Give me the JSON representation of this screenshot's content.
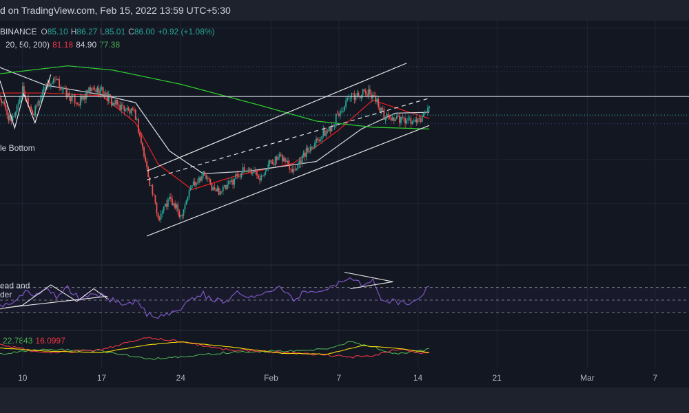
{
  "header": {
    "text": "d on TradingView.com, Feb 15, 2022 13:59 UTC+5:30"
  },
  "ohlc": {
    "exchange": "BINANCE",
    "o_label": "O",
    "o": "85.10",
    "h_label": "H",
    "h": "86.27",
    "l_label": "L",
    "l": "85.01",
    "c_label": "C",
    "c": "86.00",
    "change": "+0.92 (+1.08%)"
  },
  "ma_legend": {
    "params": "20, 50, 200)",
    "v1": "81.18",
    "v2": "84.90",
    "v3": "77.38"
  },
  "annotations": {
    "double_bottom": "le Bottom",
    "hs_line1": "ead and",
    "hs_line2": "der"
  },
  "osc_legend": {
    "v1": "22.7843",
    "v2": "16.0997"
  },
  "colors": {
    "bg": "#131722",
    "up": "#26a69a",
    "down": "#ef5350",
    "ma20": "#e02020",
    "ma50": "#d1d4dc",
    "ma200": "#2ecc2e",
    "rsi": "#7e57c2",
    "dmi_plus": "#4caf50",
    "dmi_minus": "#f23645",
    "adx": "#f5d90a"
  },
  "chart_data": {
    "type": "candlestick",
    "symbol_exchange": "BINANCE",
    "y_range": [
      68,
      96
    ],
    "x_range": [
      "2022-01-08",
      "2022-03-10"
    ],
    "x_ticks": [
      {
        "label": "10",
        "date": "2022-01-10"
      },
      {
        "label": "17",
        "date": "2022-01-17"
      },
      {
        "label": "24",
        "date": "2022-01-24"
      },
      {
        "label": "Feb",
        "date": "2022-02-01"
      },
      {
        "label": "7",
        "date": "2022-02-07"
      },
      {
        "label": "14",
        "date": "2022-02-14"
      },
      {
        "label": "21",
        "date": "2022-02-21"
      },
      {
        "label": "Mar",
        "date": "2022-03-01"
      },
      {
        "label": "7",
        "date": "2022-03-07"
      }
    ],
    "horizontal_levels": [
      87.2
    ],
    "price_path": [
      [
        "2022-01-08",
        87.0
      ],
      [
        "2022-01-09",
        84.2
      ],
      [
        "2022-01-10",
        88.0
      ],
      [
        "2022-01-11",
        85.2
      ],
      [
        "2022-01-12",
        88.6
      ],
      [
        "2022-01-13",
        88.9
      ],
      [
        "2022-01-14",
        87.3
      ],
      [
        "2022-01-15",
        86.5
      ],
      [
        "2022-01-16",
        87.9
      ],
      [
        "2022-01-17",
        87.9
      ],
      [
        "2022-01-18",
        86.4
      ],
      [
        "2022-01-19",
        85.9
      ],
      [
        "2022-01-20",
        85.0
      ],
      [
        "2022-01-21",
        79.0
      ],
      [
        "2022-01-22",
        73.4
      ],
      [
        "2022-01-23",
        75.5
      ],
      [
        "2022-01-24",
        73.7
      ],
      [
        "2022-01-25",
        77.2
      ],
      [
        "2022-01-26",
        78.4
      ],
      [
        "2022-01-27",
        76.4
      ],
      [
        "2022-01-28",
        76.7
      ],
      [
        "2022-01-29",
        78.3
      ],
      [
        "2022-01-30",
        78.9
      ],
      [
        "2022-01-31",
        78.2
      ],
      [
        "2022-02-01",
        79.8
      ],
      [
        "2022-02-02",
        80.2
      ],
      [
        "2022-02-03",
        78.9
      ],
      [
        "2022-02-04",
        80.7
      ],
      [
        "2022-02-05",
        82.3
      ],
      [
        "2022-02-06",
        83.3
      ],
      [
        "2022-02-07",
        85.2
      ],
      [
        "2022-02-08",
        87.0
      ],
      [
        "2022-02-09",
        87.6
      ],
      [
        "2022-02-10",
        87.5
      ],
      [
        "2022-02-11",
        85.0
      ],
      [
        "2022-02-12",
        84.6
      ],
      [
        "2022-02-13",
        84.4
      ],
      [
        "2022-02-14",
        84.2
      ],
      [
        "2022-02-15",
        86.0
      ]
    ],
    "channel_lines": [
      {
        "from": [
          "2022-01-21",
          71.3
        ],
        "to": [
          "2022-02-15",
          83.9
        ],
        "style": "solid"
      },
      {
        "from": [
          "2022-01-21",
          77.7
        ],
        "to": [
          "2022-02-15",
          87.0
        ],
        "style": "dashed"
      },
      {
        "from": [
          "2022-01-21",
          78.7
        ],
        "to": [
          "2022-02-13",
          91.0
        ],
        "style": "solid"
      }
    ],
    "series": [
      {
        "legend": "81.18",
        "color": "#e02020",
        "points": [
          [
            "2022-01-08",
            87.6
          ],
          [
            "2022-01-12",
            87.6
          ],
          [
            "2022-01-17",
            87.3
          ],
          [
            "2022-01-20",
            84.2
          ],
          [
            "2022-01-22",
            79.5
          ],
          [
            "2022-01-25",
            76.6
          ],
          [
            "2022-01-29",
            78.2
          ],
          [
            "2022-02-03",
            79.6
          ],
          [
            "2022-02-07",
            83.4
          ],
          [
            "2022-02-10",
            86.8
          ],
          [
            "2022-02-13",
            85.5
          ],
          [
            "2022-02-15",
            84.7
          ]
        ]
      },
      {
        "legend": "84.90",
        "color": "#d1d4dc",
        "points": [
          [
            "2022-01-08",
            90.5
          ],
          [
            "2022-01-12",
            88.5
          ],
          [
            "2022-01-17",
            87.4
          ],
          [
            "2022-01-20",
            86.5
          ],
          [
            "2022-01-23",
            81.0
          ],
          [
            "2022-01-26",
            78.4
          ],
          [
            "2022-01-30",
            78.7
          ],
          [
            "2022-02-05",
            79.8
          ],
          [
            "2022-02-09",
            83.5
          ],
          [
            "2022-02-12",
            85.3
          ],
          [
            "2022-02-15",
            85.4
          ]
        ]
      },
      {
        "legend": "77.38",
        "color": "#2ecc2e",
        "points": [
          [
            "2022-01-08",
            89.8
          ],
          [
            "2022-01-14",
            90.7
          ],
          [
            "2022-01-18",
            90.2
          ],
          [
            "2022-01-24",
            88.6
          ],
          [
            "2022-01-31",
            86.2
          ],
          [
            "2022-02-05",
            84.4
          ],
          [
            "2022-02-10",
            83.7
          ],
          [
            "2022-02-15",
            83.5
          ]
        ]
      }
    ],
    "rsi": {
      "y_range": [
        0,
        100
      ],
      "bands": [
        70,
        50,
        30
      ],
      "points": [
        [
          "2022-01-08",
          40
        ],
        [
          "2022-01-09",
          48
        ],
        [
          "2022-01-10",
          62
        ],
        [
          "2022-01-11",
          58
        ],
        [
          "2022-01-12",
          70
        ],
        [
          "2022-01-13",
          56
        ],
        [
          "2022-01-14",
          68
        ],
        [
          "2022-01-15",
          52
        ],
        [
          "2022-01-16",
          60
        ],
        [
          "2022-01-17",
          56
        ],
        [
          "2022-01-18",
          50
        ],
        [
          "2022-01-19",
          44
        ],
        [
          "2022-01-20",
          48
        ],
        [
          "2022-01-21",
          28
        ],
        [
          "2022-01-22",
          22
        ],
        [
          "2022-01-23",
          30
        ],
        [
          "2022-01-24",
          38
        ],
        [
          "2022-01-25",
          52
        ],
        [
          "2022-01-26",
          60
        ],
        [
          "2022-01-27",
          48
        ],
        [
          "2022-01-28",
          50
        ],
        [
          "2022-01-29",
          62
        ],
        [
          "2022-01-30",
          58
        ],
        [
          "2022-01-31",
          56
        ],
        [
          "2022-02-01",
          66
        ],
        [
          "2022-02-02",
          68
        ],
        [
          "2022-02-03",
          52
        ],
        [
          "2022-02-04",
          64
        ],
        [
          "2022-02-05",
          66
        ],
        [
          "2022-02-06",
          70
        ],
        [
          "2022-02-07",
          78
        ],
        [
          "2022-02-08",
          82
        ],
        [
          "2022-02-09",
          74
        ],
        [
          "2022-02-10",
          80
        ],
        [
          "2022-02-11",
          46
        ],
        [
          "2022-02-12",
          48
        ],
        [
          "2022-02-13",
          46
        ],
        [
          "2022-02-14",
          50
        ],
        [
          "2022-02-15",
          72
        ]
      ]
    },
    "dmi": {
      "y_range": [
        0,
        45
      ],
      "series": [
        {
          "legend": "22.7843",
          "color": "#4caf50",
          "points": [
            [
              "2022-01-08",
              14
            ],
            [
              "2022-01-12",
              20
            ],
            [
              "2022-01-17",
              18
            ],
            [
              "2022-01-21",
              8
            ],
            [
              "2022-01-24",
              10
            ],
            [
              "2022-01-28",
              16
            ],
            [
              "2022-02-02",
              18
            ],
            [
              "2022-02-06",
              20
            ],
            [
              "2022-02-08",
              30
            ],
            [
              "2022-02-10",
              24
            ],
            [
              "2022-02-12",
              14
            ],
            [
              "2022-02-15",
              20
            ]
          ]
        },
        {
          "legend": "16.0997",
          "color": "#f23645",
          "points": [
            [
              "2022-01-08",
              26
            ],
            [
              "2022-01-12",
              15
            ],
            [
              "2022-01-17",
              20
            ],
            [
              "2022-01-21",
              36
            ],
            [
              "2022-01-24",
              30
            ],
            [
              "2022-01-28",
              20
            ],
            [
              "2022-02-02",
              16
            ],
            [
              "2022-02-06",
              13
            ],
            [
              "2022-02-08",
              10
            ],
            [
              "2022-02-10",
              12
            ],
            [
              "2022-02-12",
              20
            ],
            [
              "2022-02-15",
              15
            ]
          ]
        },
        {
          "legend": "",
          "color": "#f5d90a",
          "points": [
            [
              "2022-01-08",
              22
            ],
            [
              "2022-01-12",
              18
            ],
            [
              "2022-01-17",
              16
            ],
            [
              "2022-01-21",
              26
            ],
            [
              "2022-01-24",
              30
            ],
            [
              "2022-01-28",
              24
            ],
            [
              "2022-02-02",
              15
            ],
            [
              "2022-02-06",
              14
            ],
            [
              "2022-02-09",
              25
            ],
            [
              "2022-02-12",
              22
            ],
            [
              "2022-02-15",
              16
            ]
          ]
        }
      ]
    }
  }
}
